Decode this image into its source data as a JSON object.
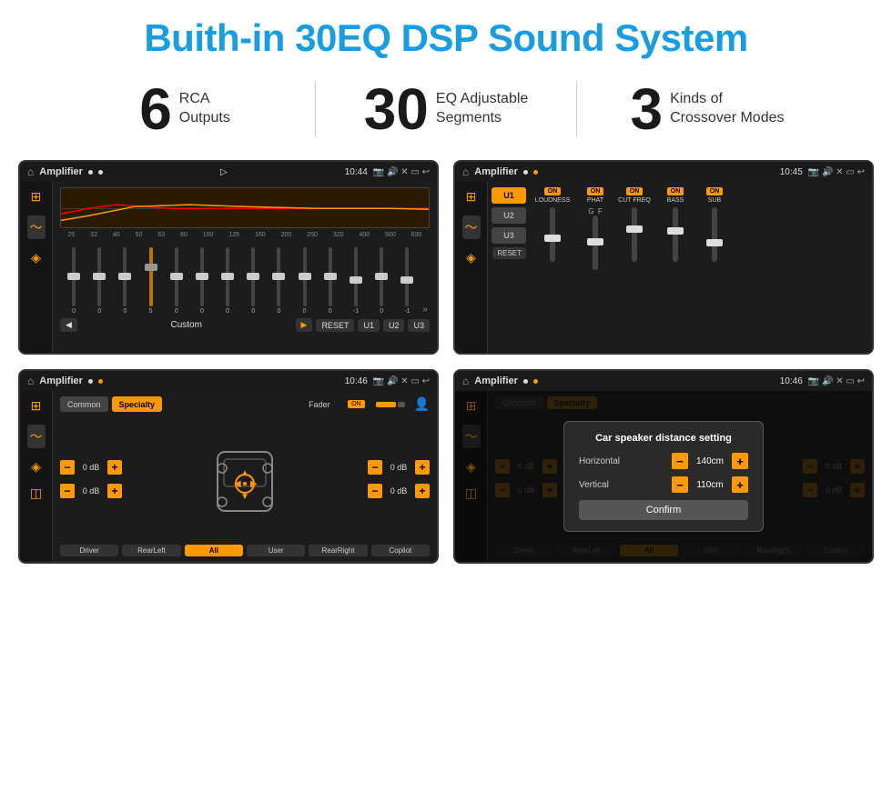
{
  "header": {
    "title": "Buith-in 30EQ DSP Sound System"
  },
  "stats": [
    {
      "number": "6",
      "label": "RCA\nOutputs"
    },
    {
      "number": "30",
      "label": "EQ Adjustable\nSegments"
    },
    {
      "number": "3",
      "label": "Kinds of\nCrossover Modes"
    }
  ],
  "screens": [
    {
      "id": "screen-eq",
      "app_name": "Amplifier",
      "time": "10:44",
      "freq_labels": [
        "25",
        "32",
        "40",
        "50",
        "63",
        "80",
        "100",
        "125",
        "160",
        "200",
        "250",
        "320",
        "400",
        "500",
        "630"
      ],
      "slider_values": [
        "0",
        "0",
        "0",
        "5",
        "0",
        "0",
        "0",
        "0",
        "0",
        "0",
        "0",
        "-1",
        "0",
        "-1"
      ],
      "custom_label": "Custom",
      "buttons": [
        "RESET",
        "U1",
        "U2",
        "U3"
      ]
    },
    {
      "id": "screen-crossover",
      "app_name": "Amplifier",
      "time": "10:45",
      "channels": [
        "U1",
        "U2",
        "U3"
      ],
      "sections": [
        "LOUDNESS",
        "PHAT",
        "CUT FREQ",
        "BASS",
        "SUB"
      ],
      "reset_label": "RESET"
    },
    {
      "id": "screen-fader",
      "app_name": "Amplifier",
      "time": "10:46",
      "tabs": [
        "Common",
        "Specialty"
      ],
      "fader_label": "Fader",
      "vol_values": [
        "0 dB",
        "0 dB",
        "0 dB",
        "0 dB"
      ],
      "bottom_btns": [
        "Driver",
        "RearLeft",
        "All",
        "User",
        "RearRight",
        "Copilot"
      ]
    },
    {
      "id": "screen-dialog",
      "app_name": "Amplifier",
      "time": "10:46",
      "tabs": [
        "Common",
        "Specialty"
      ],
      "dialog": {
        "title": "Car speaker distance setting",
        "horizontal_label": "Horizontal",
        "horizontal_value": "140cm",
        "vertical_label": "Vertical",
        "vertical_value": "110cm",
        "confirm_label": "Confirm"
      },
      "bottom_btns": [
        "Driver",
        "RearLeft",
        "All",
        "User",
        "RearRight",
        "Copilot"
      ]
    }
  ]
}
